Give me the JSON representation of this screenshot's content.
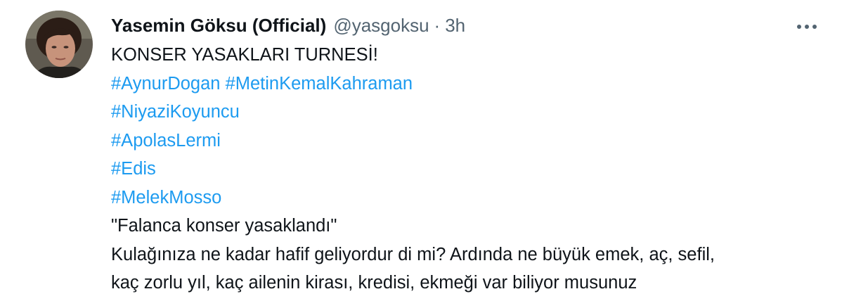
{
  "tweet": {
    "author": {
      "display_name": "Yasemin Göksu (Official)",
      "handle": "@yasgoksu",
      "separator": "·",
      "time": "3h",
      "avatar_icon": "profile-photo"
    },
    "more_icon": "more-options-icon",
    "lines": [
      {
        "type": "text",
        "text": "KONSER YASAKLARI TURNESİ!"
      },
      {
        "type": "hashtags",
        "tags": [
          "#AynurDogan",
          "#MetinKemalKahraman"
        ]
      },
      {
        "type": "hashtags",
        "tags": [
          "#NiyaziKoyuncu"
        ]
      },
      {
        "type": "hashtags",
        "tags": [
          "#ApolasLermi"
        ]
      },
      {
        "type": "hashtags",
        "tags": [
          "#Edis"
        ]
      },
      {
        "type": "hashtags",
        "tags": [
          "#MelekMosso"
        ]
      },
      {
        "type": "text",
        "text": "\"Falanca konser yasaklandı\""
      },
      {
        "type": "text",
        "text": "Kulağınıza ne kadar hafif geliyordur di mi? Ardında ne büyük emek, aç, sefil,"
      },
      {
        "type": "text",
        "text": "kaç zorlu yıl, kaç ailenin kirası, kredisi, ekmeği var biliyor musunuz"
      }
    ],
    "colors": {
      "text": "#0f1419",
      "secondary": "#536471",
      "link": "#1d9bf0",
      "background": "#ffffff"
    }
  }
}
